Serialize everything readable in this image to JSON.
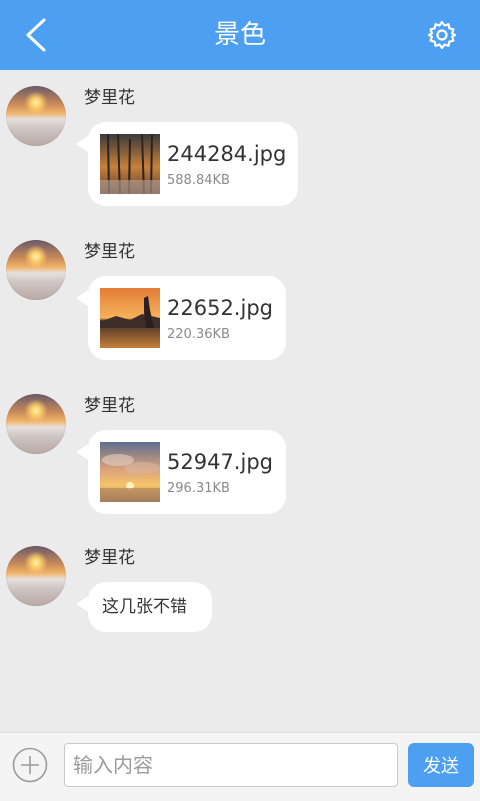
{
  "header": {
    "title": "景色",
    "back_icon": "chevron-left-icon",
    "settings_icon": "gear-icon",
    "color": "#4d9ff2"
  },
  "messages": [
    {
      "sender": "梦里花",
      "type": "file",
      "file_name": "244284.jpg",
      "file_size": "588.84KB"
    },
    {
      "sender": "梦里花",
      "type": "file",
      "file_name": "22652.jpg",
      "file_size": "220.36KB"
    },
    {
      "sender": "梦里花",
      "type": "file",
      "file_name": "52947.jpg",
      "file_size": "296.31KB"
    },
    {
      "sender": "梦里花",
      "type": "text",
      "text": "这几张不错"
    }
  ],
  "composer": {
    "placeholder": "输入内容",
    "send_label": "发送",
    "add_icon": "plus-circle-icon"
  }
}
